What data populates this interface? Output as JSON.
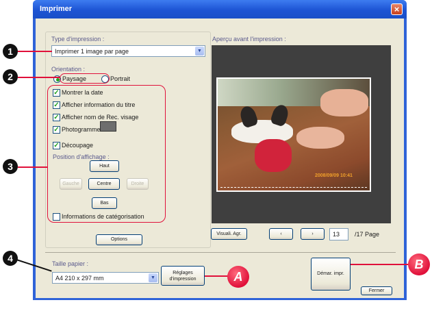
{
  "window": {
    "title": "Imprimer",
    "close_icon": "close-icon"
  },
  "print_type": {
    "label": "Type d'impression :",
    "value": "Imprimer 1 image par page"
  },
  "orientation": {
    "label": "Orientation :",
    "landscape": "Paysage",
    "portrait": "Portrait",
    "selected": "Paysage"
  },
  "options": {
    "show_date": "Montrer la date",
    "show_title": "Afficher information du titre",
    "show_face_name": "Afficher nom de Rec. visage",
    "frame": "Photogramme",
    "crop": "Découpage",
    "position_label": "Position d'affichage :",
    "pos_top": "Haut",
    "pos_left": "Gauche",
    "pos_center": "Centre",
    "pos_right": "Droite",
    "pos_bottom": "Bas",
    "categorization": "Informations de catégorisation"
  },
  "options_button": "Options",
  "preview": {
    "label": "Aperçu avant l'impression :",
    "date_stamp": "2008/09/09 10:41",
    "visual_button": "Visuali. Agr.",
    "current_page": "13",
    "total_pages": "/17 Page"
  },
  "paper": {
    "label": "Taille papier :",
    "value": "A4 210 x 297 mm",
    "settings_button_line1": "Réglages",
    "settings_button_line2": "d'impression"
  },
  "start_button": "Démar. impr.",
  "close_button": "Fermer",
  "callouts": {
    "c1": "1",
    "c2": "2",
    "c3": "3",
    "c4": "4",
    "cA": "A",
    "cB": "B"
  }
}
